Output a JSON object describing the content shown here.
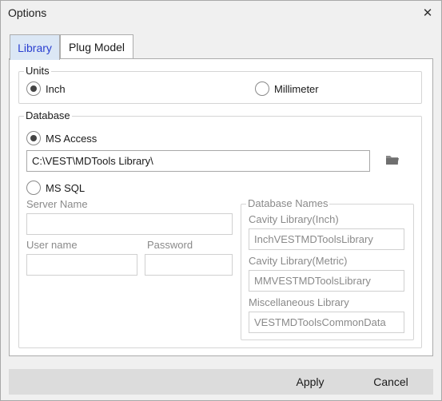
{
  "window": {
    "title": "Options",
    "close_glyph": "✕"
  },
  "tabs": [
    {
      "label": "Library",
      "active": true
    },
    {
      "label": "Plug Model",
      "active": false
    }
  ],
  "units": {
    "legend": "Units",
    "options": [
      {
        "label": "Inch",
        "checked": true
      },
      {
        "label": "Millimeter",
        "checked": false
      }
    ]
  },
  "database": {
    "legend": "Database",
    "ms_access": {
      "label": "MS Access",
      "checked": true,
      "path": "C:\\VEST\\MDTools Library\\"
    },
    "ms_sql": {
      "label": "MS SQL",
      "checked": false,
      "server_name_label": "Server Name",
      "server_name_value": "",
      "user_name_label": "User name",
      "user_name_value": "",
      "password_label": "Password",
      "password_value": ""
    },
    "names": {
      "legend": "Database Names",
      "cavity_inch_label": "Cavity Library(Inch)",
      "cavity_inch_value": "InchVESTMDToolsLibrary",
      "cavity_metric_label": "Cavity Library(Metric)",
      "cavity_metric_value": "MMVESTMDToolsLibrary",
      "misc_label": "Miscellaneous Library",
      "misc_value": "VESTMDToolsCommonData"
    }
  },
  "footer": {
    "apply_label": "Apply",
    "cancel_label": "Cancel"
  },
  "colors": {
    "active_tab_bg": "#dbe7f5",
    "active_tab_text": "#2a3fd0",
    "footer_bg": "#dcdcdc",
    "folder_icon": "#6f6f6f"
  },
  "icons": {
    "folder": "folder-icon",
    "close": "close-icon"
  }
}
